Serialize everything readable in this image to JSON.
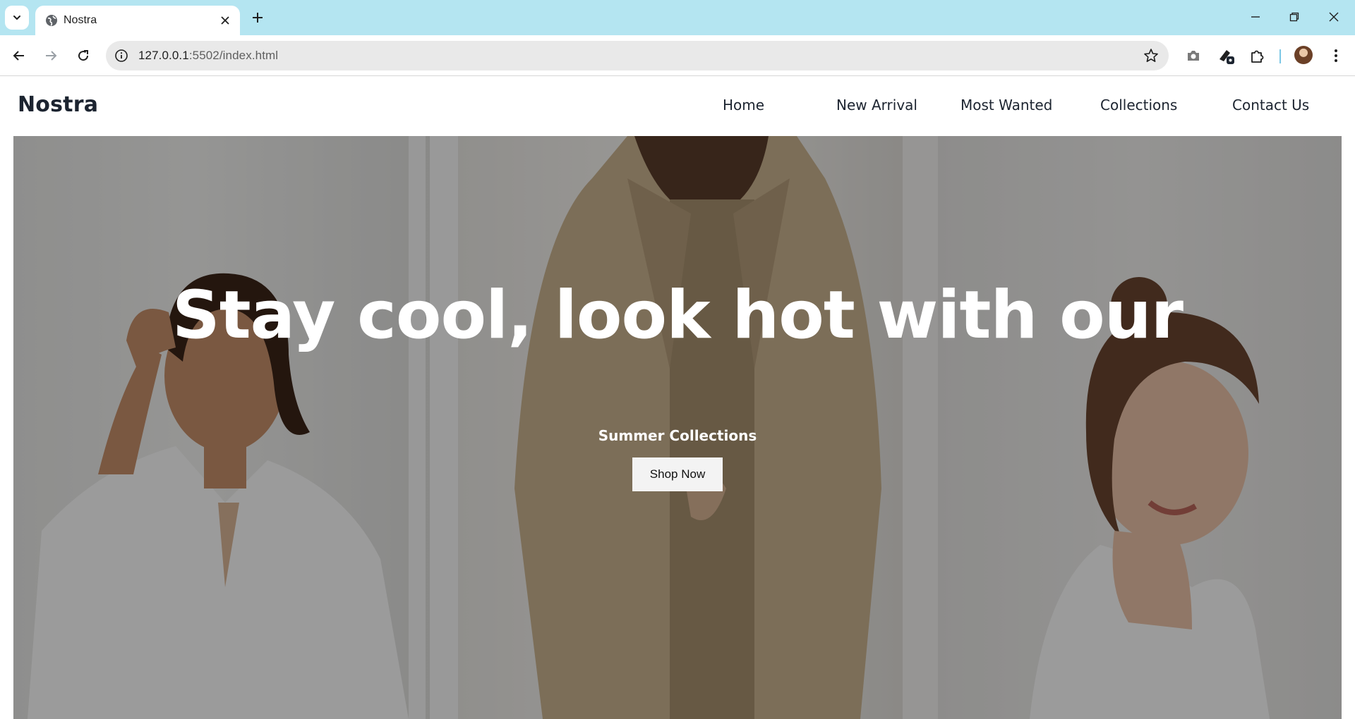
{
  "browser": {
    "tab_title": "Nostra",
    "url_host": "127.0.0.1",
    "url_rest": ":5502/index.html"
  },
  "site": {
    "logo": "Nostra",
    "nav": [
      "Home",
      "New Arrival",
      "Most Wanted",
      "Collections",
      "Contact Us"
    ]
  },
  "hero": {
    "heading": "Stay cool, look hot with our",
    "subheading": "Summer Collections",
    "cta_label": "Shop Now"
  },
  "colors": {
    "tabstrip": "#b4e5f1",
    "text_dark": "#1c2430",
    "hero_text": "#ffffff"
  }
}
